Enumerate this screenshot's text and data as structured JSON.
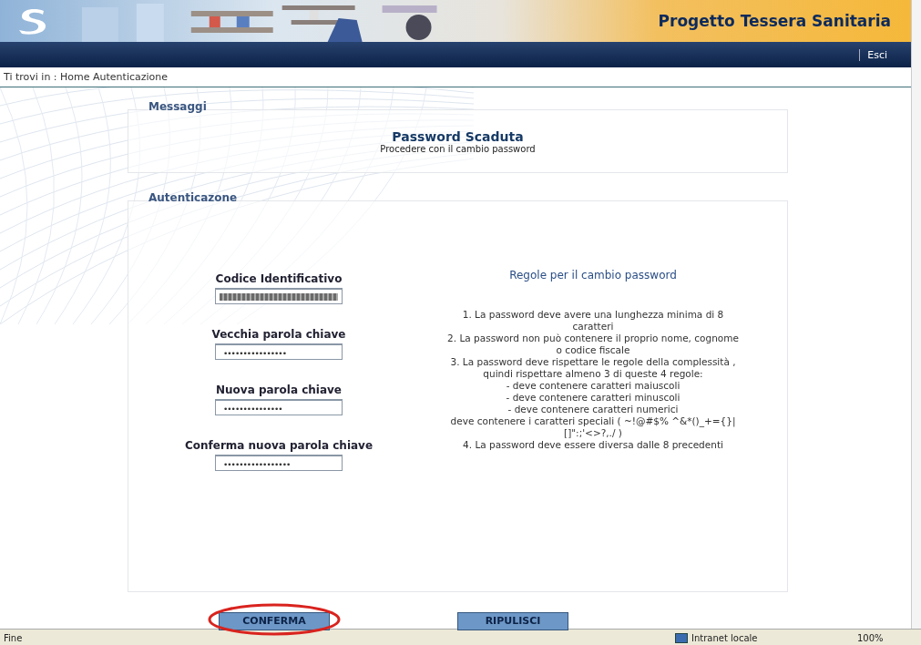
{
  "header": {
    "title": "Progetto Tessera Sanitaria"
  },
  "nav": {
    "links": [
      "Esci"
    ]
  },
  "breadcrumb": {
    "text": "Ti trovi in : Home  Autenticazione"
  },
  "messages": {
    "legend": "Messaggi",
    "title": "Password Scaduta",
    "text": "Procedere con il cambio password"
  },
  "auth": {
    "legend": "Autenticazone",
    "fields": [
      {
        "label": "Codice Identificativo",
        "kind": "redacted"
      },
      {
        "label": "Vecchia parola chiave",
        "kind": "password",
        "value": "••••••••••••••••"
      },
      {
        "label": "Nuova parola chiave",
        "kind": "password",
        "value": "•••••••••••••••"
      },
      {
        "label": "Conferma nuova parola chiave",
        "kind": "password",
        "value": "•••••••••••••••••"
      }
    ],
    "rules_title": "Regole per il cambio password",
    "rules": [
      {
        "number": "1.",
        "text": "La password deve avere una lunghezza minima di 8 caratteri"
      },
      {
        "number": "2.",
        "text": "La password non può contenere il proprio nome, cognome o codice fiscale"
      },
      {
        "number": "3.",
        "text": "La password deve rispettare le regole della complessità , quindi rispettare almeno 3 di queste 4 regole:",
        "sub": [
          "- deve contenere caratteri maiuscoli",
          "- deve contenere caratteri minuscoli",
          "- deve contenere caratteri numerici",
          "deve contenere i caratteri speciali ( ~!@#$% ^&*()_+={}|[]\":;'<>?,./ )"
        ]
      },
      {
        "number": "4.",
        "text": "La password deve essere diversa dalle 8 precedenti"
      }
    ]
  },
  "buttons": [
    {
      "label": "CONFERMA",
      "highlighted": true
    },
    {
      "label": "RIPULISCI",
      "highlighted": false
    }
  ],
  "status_bar": {
    "text": "Fine",
    "zone": "Intranet locale",
    "zoom": "100%"
  }
}
